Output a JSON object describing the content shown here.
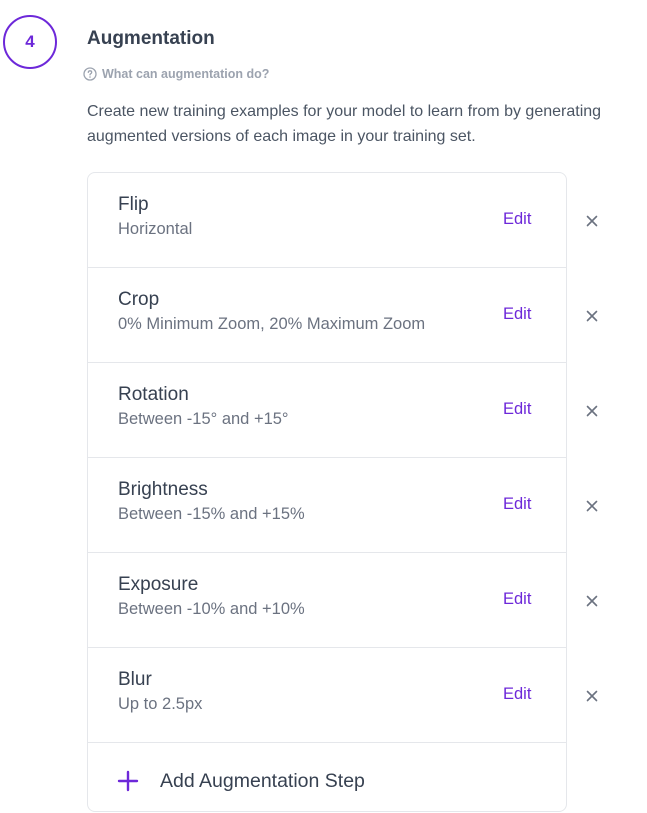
{
  "step": {
    "number": "4"
  },
  "section": {
    "title": "Augmentation",
    "help_link": "What can augmentation do?",
    "description_line1": "Create new training examples for your model to learn from by generating",
    "description_line2": "augmented versions of each image in your training set."
  },
  "augmentations": [
    {
      "name": "Flip",
      "detail": "Horizontal",
      "edit_label": "Edit"
    },
    {
      "name": "Crop",
      "detail": "0% Minimum Zoom, 20% Maximum Zoom",
      "edit_label": "Edit"
    },
    {
      "name": "Rotation",
      "detail": "Between -15° and +15°",
      "edit_label": "Edit"
    },
    {
      "name": "Brightness",
      "detail": "Between -15% and +15%",
      "edit_label": "Edit"
    },
    {
      "name": "Exposure",
      "detail": "Between -10% and +10%",
      "edit_label": "Edit"
    },
    {
      "name": "Blur",
      "detail": "Up to 2.5px",
      "edit_label": "Edit"
    }
  ],
  "add_step": {
    "label": "Add Augmentation Step"
  },
  "icons": {
    "help": "question-circle-icon",
    "remove": "close-icon",
    "add": "plus-icon"
  },
  "colors": {
    "accent": "#6d28d9",
    "text": "#374151",
    "muted": "#6b7280",
    "border": "#e5e7eb"
  }
}
